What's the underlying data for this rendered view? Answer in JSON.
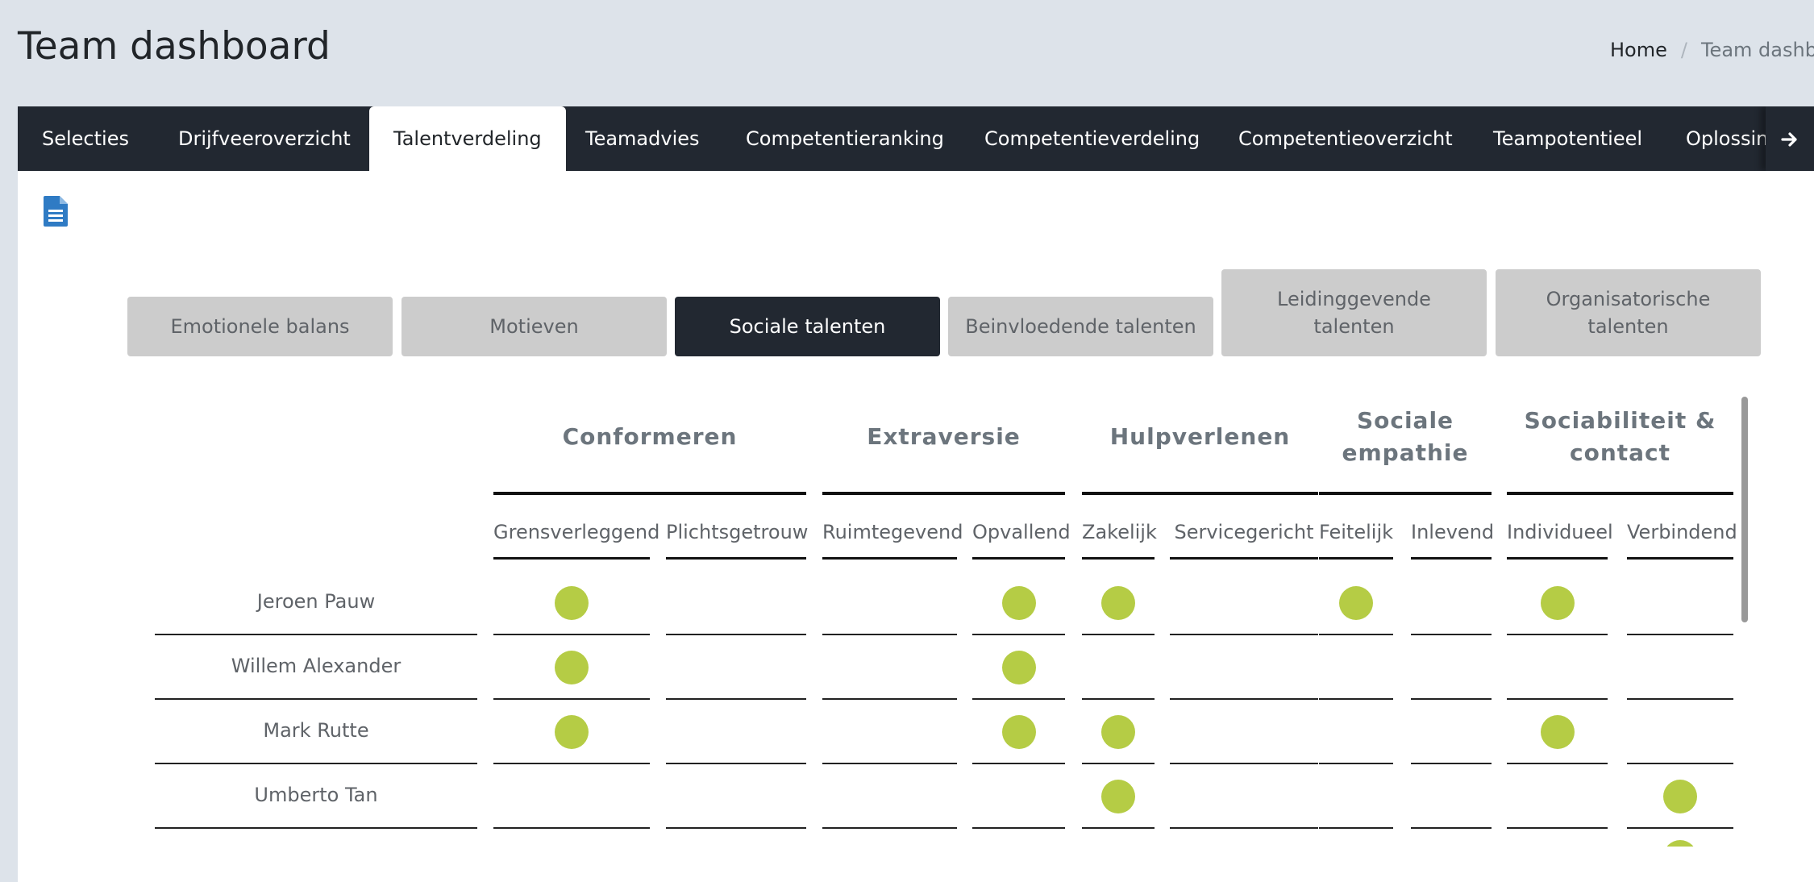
{
  "page": {
    "title": "Team dashboard",
    "breadcrumb": {
      "home": "Home",
      "separator": "/",
      "current": "Team dashboard"
    }
  },
  "tabs": [
    {
      "label": "Selecties"
    },
    {
      "label": "Drijfveeroverzicht"
    },
    {
      "label": "Talentverdeling",
      "active": true
    },
    {
      "label": "Teamadvies"
    },
    {
      "label": "Competentieranking"
    },
    {
      "label": "Competentieverdeling"
    },
    {
      "label": "Competentieoverzicht"
    },
    {
      "label": "Teampotentieel"
    },
    {
      "label": "Oplossing"
    }
  ],
  "tab_arrow_icon": "arrow-right-icon",
  "doc_icon": "document-icon",
  "categories": [
    {
      "label": "Emotionele balans"
    },
    {
      "label": "Motieven"
    },
    {
      "label": "Sociale talenten",
      "active": true
    },
    {
      "label": "Beinvloedende talenten"
    },
    {
      "label": "Leidinggevende talenten"
    },
    {
      "label": "Organisatorische talenten"
    }
  ],
  "groups": [
    {
      "label": "Conformeren",
      "subs": [
        "Grensverleggend",
        "Plichtsgetrouw"
      ]
    },
    {
      "label": "Extraversie",
      "subs": [
        "Ruimtegevend",
        "Opvallend"
      ]
    },
    {
      "label": "Hulpverlenen",
      "subs": [
        "Zakelijk",
        "Servicegericht"
      ]
    },
    {
      "label": "Sociale empathie",
      "subs": [
        "Feitelijk",
        "Inlevend"
      ]
    },
    {
      "label": "Sociabiliteit & contact",
      "subs": [
        "Individueel",
        "Verbindend"
      ]
    }
  ],
  "rows": [
    {
      "name": "Jeroen Pauw",
      "marks": [
        1,
        0,
        0,
        1,
        1,
        0,
        1,
        0,
        1,
        0
      ]
    },
    {
      "name": "Willem Alexander",
      "marks": [
        1,
        0,
        0,
        1,
        0,
        0,
        0,
        0,
        0,
        0
      ]
    },
    {
      "name": "Mark Rutte",
      "marks": [
        1,
        0,
        0,
        1,
        1,
        0,
        0,
        0,
        1,
        0
      ]
    },
    {
      "name": "Umberto Tan",
      "marks": [
        0,
        0,
        0,
        0,
        1,
        0,
        0,
        0,
        0,
        1
      ]
    }
  ],
  "colors": {
    "accent_dot": "#b5cc45",
    "tabbar_bg": "#222831",
    "active_button_bg": "#222831",
    "inactive_button_bg": "#cccccc",
    "page_bg": "#dde3ea",
    "doc_icon": "#2f7bc4"
  }
}
